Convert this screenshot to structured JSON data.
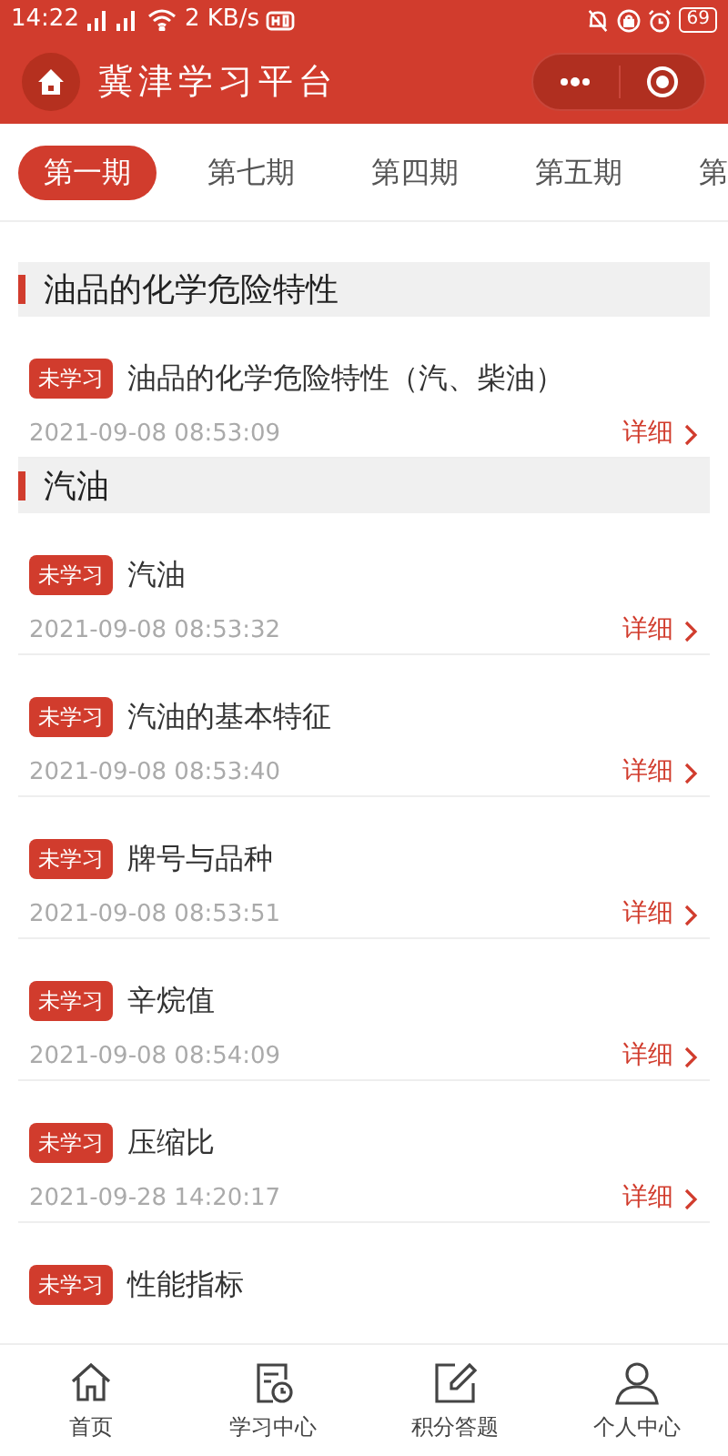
{
  "status_bar": {
    "time": "14:22",
    "speed": "2 KB/s",
    "battery": "69"
  },
  "header": {
    "title": "冀津学习平台"
  },
  "tabs": [
    {
      "label": "第一期",
      "selected": true
    },
    {
      "label": "第七期",
      "selected": false
    },
    {
      "label": "第四期",
      "selected": false
    },
    {
      "label": "第五期",
      "selected": false
    },
    {
      "label": "第",
      "selected": false
    }
  ],
  "sections": [
    {
      "title": "油品的化学危险特性",
      "items": [
        {
          "tag": "未学习",
          "title": "油品的化学危险特性（汽、柴油）",
          "date": "2021-09-08 08:53:09",
          "link": "详细"
        }
      ]
    },
    {
      "title": "汽油",
      "items": [
        {
          "tag": "未学习",
          "title": "汽油",
          "date": "2021-09-08 08:53:32",
          "link": "详细"
        },
        {
          "tag": "未学习",
          "title": "汽油的基本特征",
          "date": "2021-09-08 08:53:40",
          "link": "详细"
        },
        {
          "tag": "未学习",
          "title": "牌号与品种",
          "date": "2021-09-08 08:53:51",
          "link": "详细"
        },
        {
          "tag": "未学习",
          "title": "辛烷值",
          "date": "2021-09-08 08:54:09",
          "link": "详细"
        },
        {
          "tag": "未学习",
          "title": "压缩比",
          "date": "2021-09-28 14:20:17",
          "link": "详细"
        },
        {
          "tag": "未学习",
          "title": "性能指标"
        }
      ]
    }
  ],
  "bottom_nav": [
    {
      "label": "首页",
      "kind": "home"
    },
    {
      "label": "学习中心",
      "kind": "study"
    },
    {
      "label": "积分答题",
      "kind": "quiz"
    },
    {
      "label": "个人中心",
      "kind": "profile"
    }
  ]
}
